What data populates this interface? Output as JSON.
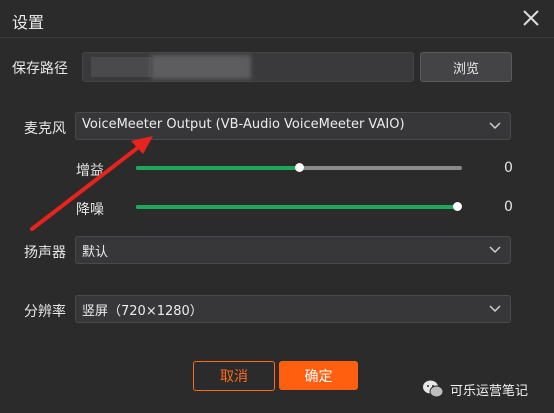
{
  "dialog": {
    "title": "设置"
  },
  "save_path": {
    "label": "保存路径",
    "browse_label": "浏览"
  },
  "microphone": {
    "label": "麦克风",
    "selected": "VoiceMeeter Output (VB-Audio VoiceMeeter VAIO)"
  },
  "gain": {
    "label": "增益",
    "value_text": "0",
    "level": 0.5
  },
  "noise_reduction": {
    "label": "降噪",
    "value_text": "0",
    "level": 1.0
  },
  "speaker": {
    "label": "扬声器",
    "selected": "默认"
  },
  "resolution": {
    "label": "分辨率",
    "selected": "竖屏（720×1280）"
  },
  "buttons": {
    "cancel": "取消",
    "confirm": "确定"
  },
  "watermark": {
    "text": "可乐运营笔记"
  },
  "colors": {
    "accent": "#ff5f0e",
    "slider_fill": "#1fa85a",
    "annotation_arrow": "#e8231e"
  }
}
